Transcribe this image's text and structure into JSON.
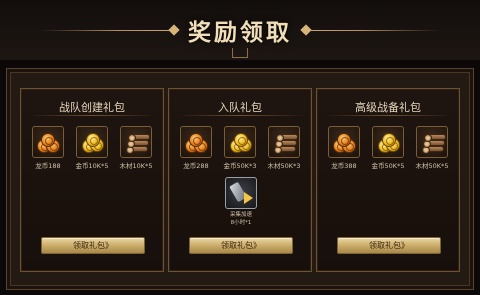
{
  "header": {
    "title": "奖励领取"
  },
  "cards": [
    {
      "title": "战队创建礼包",
      "items": [
        {
          "icon": "dragon-coin-icon",
          "label": "龙币188"
        },
        {
          "icon": "gold-coin-icon",
          "label": "金币10K*5"
        },
        {
          "icon": "wood-logs-icon",
          "label": "木材10K*5"
        }
      ],
      "button_label": "领取礼包》"
    },
    {
      "title": "入队礼包",
      "items": [
        {
          "icon": "dragon-coin-icon",
          "label": "龙币288"
        },
        {
          "icon": "gold-coin-icon",
          "label": "金币50K*3"
        },
        {
          "icon": "wood-logs-icon",
          "label": "木材50K*3"
        }
      ],
      "special_item": {
        "icon": "speedup-item-icon",
        "label_line1": "采集加速",
        "label_line2": "8小时*1"
      },
      "button_label": "领取礼包》"
    },
    {
      "title": "高级战备礼包",
      "items": [
        {
          "icon": "dragon-coin-icon",
          "label": "龙币388"
        },
        {
          "icon": "gold-coin-icon",
          "label": "金币50K*5"
        },
        {
          "icon": "wood-logs-icon",
          "label": "木材50K*5"
        }
      ],
      "button_label": "领取礼包》"
    }
  ],
  "colors": {
    "background": "#0b0807",
    "panel": "#241a14",
    "border_gold": "#6e5131",
    "title_text": "#f1dfb9",
    "button_gold": "#c8a864"
  }
}
